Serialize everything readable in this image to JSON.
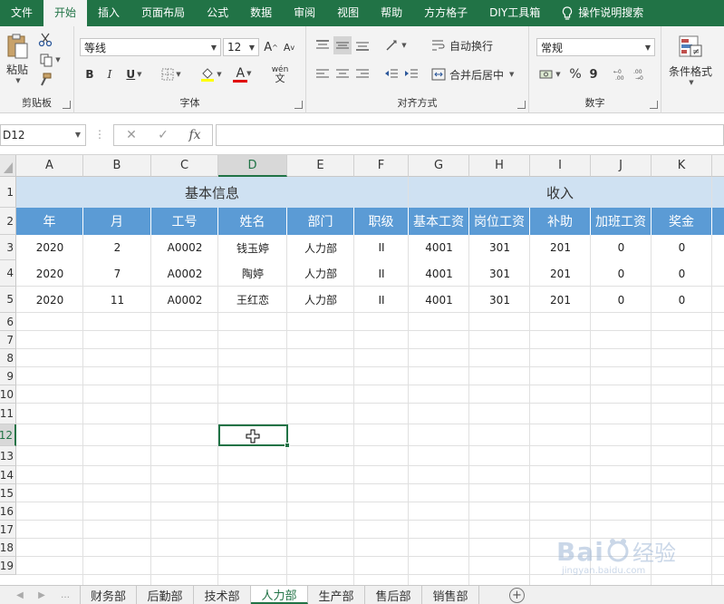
{
  "menu": {
    "tabs": [
      "文件",
      "开始",
      "插入",
      "页面布局",
      "公式",
      "数据",
      "审阅",
      "视图",
      "帮助",
      "方方格子",
      "DIY工具箱"
    ],
    "active_tab": "开始",
    "tell_me": "操作说明搜索"
  },
  "ribbon": {
    "clipboard": {
      "paste": "粘贴",
      "label": "剪贴板"
    },
    "font": {
      "name": "等线",
      "size": "12",
      "grow": "A",
      "shrink": "A",
      "bold": "B",
      "italic": "I",
      "underline": "U",
      "color_letter": "A",
      "phonetic_top": "wén",
      "phonetic_bottom": "文",
      "label": "字体"
    },
    "alignment": {
      "wrap": "自动换行",
      "merge": "合并后居中",
      "label": "对齐方式"
    },
    "number": {
      "format": "常规",
      "percent": "%",
      "comma": "9",
      "label": "数字"
    },
    "styles": {
      "conditional": "条件格式"
    }
  },
  "formula_bar": {
    "name_box": "D12",
    "fx": "fx",
    "formula": ""
  },
  "columns": [
    "A",
    "B",
    "C",
    "D",
    "E",
    "F",
    "G",
    "H",
    "I",
    "J",
    "K"
  ],
  "selected_column": "D",
  "rows": [
    "1",
    "2",
    "3",
    "4",
    "5",
    "6",
    "7",
    "8",
    "9",
    "10",
    "11",
    "12",
    "13",
    "14",
    "15",
    "16",
    "17",
    "18",
    "19"
  ],
  "selected_row": "12",
  "table": {
    "group_basic": "基本信息",
    "group_income": "收入",
    "headers": [
      "年",
      "月",
      "工号",
      "姓名",
      "部门",
      "职级",
      "基本工资",
      "岗位工资",
      "补助",
      "加班工资",
      "奖金"
    ],
    "rows": [
      [
        "2020",
        "2",
        "A0002",
        "钱玉婷",
        "人力部",
        "II",
        "4001",
        "301",
        "201",
        "0",
        "0"
      ],
      [
        "2020",
        "7",
        "A0002",
        "陶婷",
        "人力部",
        "II",
        "4001",
        "301",
        "201",
        "0",
        "0"
      ],
      [
        "2020",
        "11",
        "A0002",
        "王红恋",
        "人力部",
        "II",
        "4001",
        "301",
        "201",
        "0",
        "0"
      ]
    ]
  },
  "sheets": [
    "财务部",
    "后勤部",
    "技术部",
    "人力部",
    "生产部",
    "售后部",
    "销售部"
  ],
  "active_sheet": "人力部",
  "watermark": {
    "brand": "Baidu经验",
    "url": "jingyan.baidu.com"
  },
  "colors": {
    "excel_green": "#217346",
    "header_blue": "#5b9bd5",
    "band_blue": "#cfe1f2"
  }
}
